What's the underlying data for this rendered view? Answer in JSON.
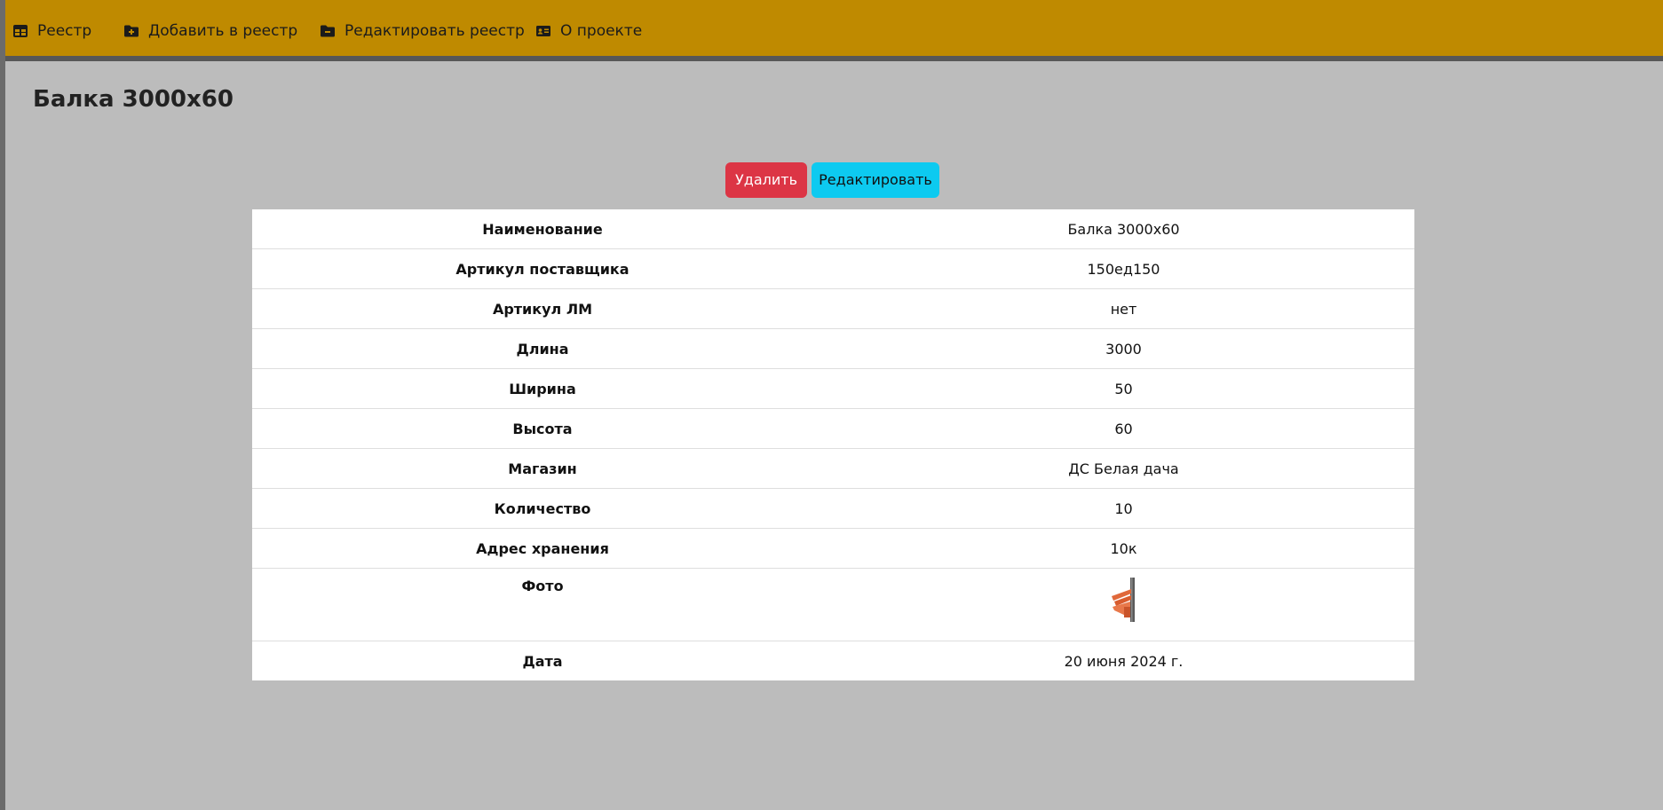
{
  "nav": {
    "items": [
      {
        "label": "Реестр",
        "icon": "table-icon"
      },
      {
        "label": "Добавить в реестр",
        "icon": "folder-plus-icon"
      },
      {
        "label": "Редактировать реестр",
        "icon": "folder-minus-icon"
      },
      {
        "label": "О проекте",
        "icon": "id-card-icon"
      }
    ]
  },
  "page": {
    "title": "Балка 3000x60"
  },
  "actions": {
    "delete_label": "Удалить",
    "edit_label": "Редактировать"
  },
  "details": {
    "rows": [
      {
        "label": "Наименование",
        "value": "Балка 3000x60"
      },
      {
        "label": "Артикул поставщика",
        "value": "150ед150"
      },
      {
        "label": "Артикул ЛМ",
        "value": "нет"
      },
      {
        "label": "Длина",
        "value": "3000"
      },
      {
        "label": "Ширина",
        "value": "50"
      },
      {
        "label": "Высота",
        "value": "60"
      },
      {
        "label": "Магазин",
        "value": "ДС Белая дача"
      },
      {
        "label": "Количество",
        "value": "10"
      },
      {
        "label": "Адрес хранения",
        "value": "10к"
      },
      {
        "label": "Фото",
        "value": ""
      },
      {
        "label": "Дата",
        "value": "20 июня 2024 г."
      }
    ]
  },
  "colors": {
    "navbar": "#bf8a00",
    "background": "#bcbcbc",
    "delete_button": "#dc3545",
    "edit_button": "#0dcaf0"
  }
}
